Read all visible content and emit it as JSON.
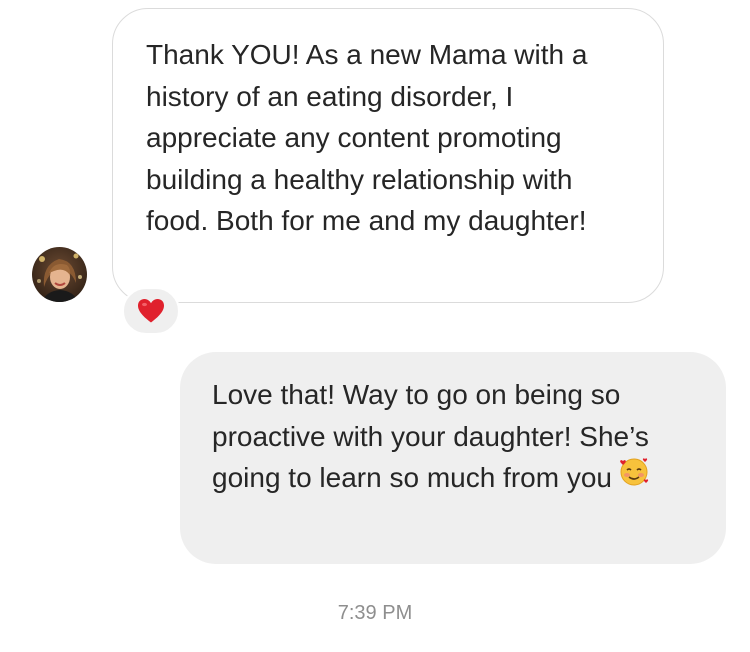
{
  "thread": {
    "incoming_message": {
      "text": "Thank YOU! As a new Mama with a history of an eating disorder, I appreciate any content promoting building a healthy relationship with food. Both for me and my daughter!",
      "reaction_icon": "red-heart-icon"
    },
    "outgoing_message": {
      "text": "Love that! Way to go on being so proactive with your daughter! She’s going to learn so much from you",
      "emoji_icon": "smiling-face-with-hearts-icon"
    },
    "timestamp": "7:39 PM"
  },
  "colors": {
    "incoming_border": "#dbdbdb",
    "outgoing_bubble": "#efefef",
    "reaction_heart": "#e0212d",
    "timestamp_text": "#8e8e8e",
    "message_text": "#262626"
  }
}
